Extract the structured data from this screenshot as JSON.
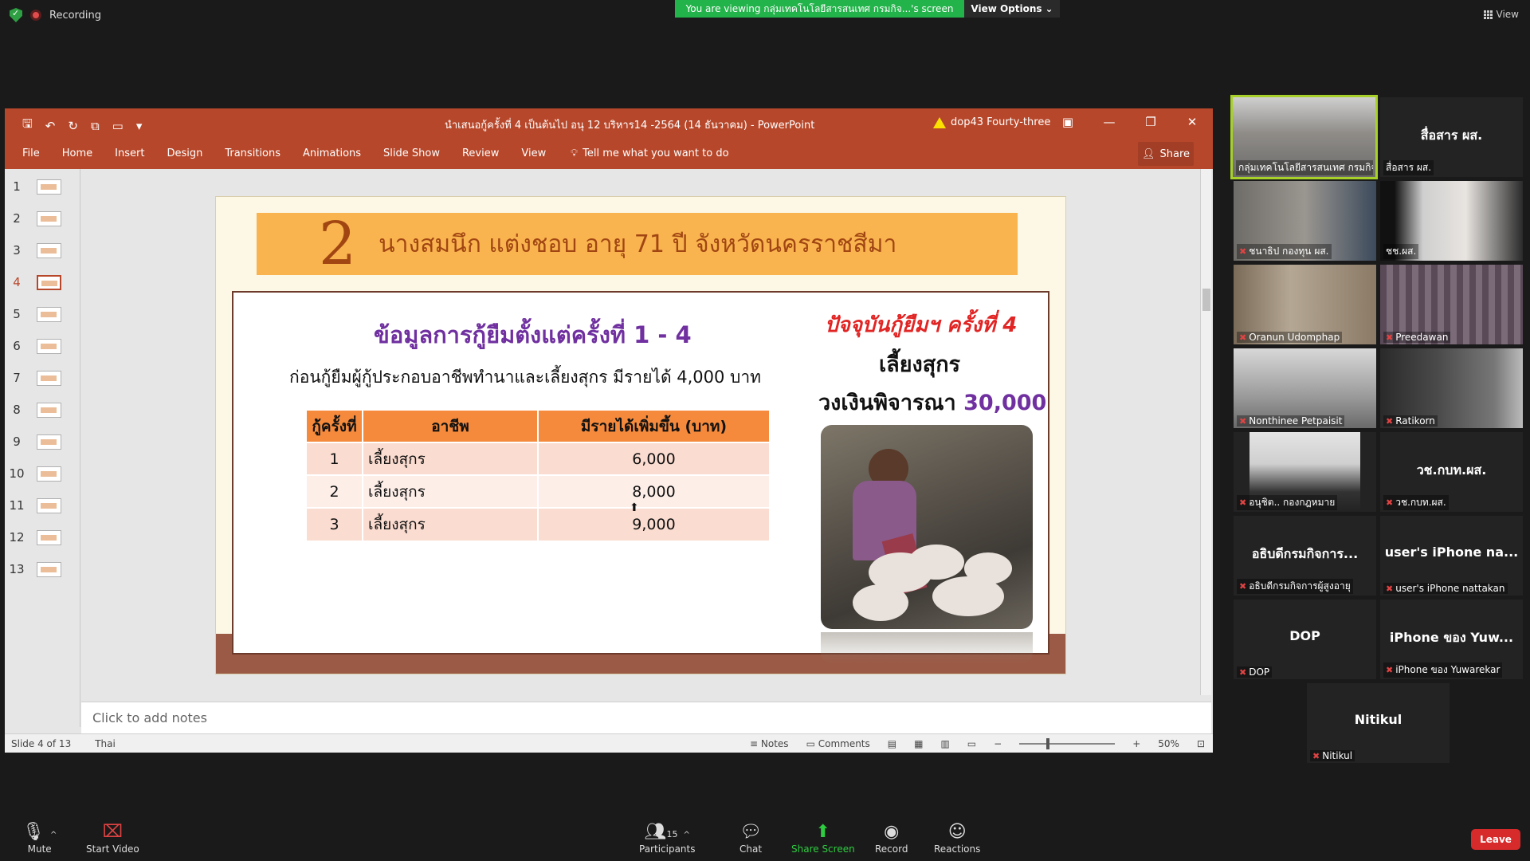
{
  "zoom": {
    "recording_label": "Recording",
    "viewing_banner": "You are viewing กลุ่มเทคโนโลยีสารสนเทศ กรมกิจ...'s screen",
    "view_options": "View Options",
    "view_label": "View"
  },
  "ppt": {
    "doc_title": "นำเสนอกู้ครั้งที่ 4 เป็นต้นไป อนุ 12 บริหาร14 -2564 (14 ธันวาคม)  -  PowerPoint",
    "user_name": "dop43 Fourty-three",
    "tabs": [
      "File",
      "Home",
      "Insert",
      "Design",
      "Transitions",
      "Animations",
      "Slide Show",
      "Review",
      "View"
    ],
    "tell_me": "Tell me what you want to do",
    "share_label": "Share",
    "slide_numbers": [
      "1",
      "2",
      "3",
      "4",
      "5",
      "6",
      "7",
      "8",
      "9",
      "10",
      "11",
      "12",
      "13"
    ],
    "notes_placeholder": "Click to add notes",
    "status_slide": "Slide 4 of 13",
    "status_lang": "Thai",
    "status_notes": "Notes",
    "status_comments": "Comments",
    "zoom_level": "50%"
  },
  "slide": {
    "number": "2",
    "name": "นางสมนึก  แต่งชอบ  อายุ 71 ปี  จังหวัดนครราชสีมา",
    "history_title": "ข้อมูลการกู้ยืมตั้งแต่ครั้งที่ 1 - 4",
    "before_text": "ก่อนกู้ยืมผู้กู้ประกอบอาชีพทำนาและเลี้ยงสุกร   มีรายได้  4,000  บาท",
    "table_headers": [
      "กู้ครั้งที่",
      "อาชีพ",
      "มีรายได้เพิ่มขึ้น (บาท)"
    ],
    "table_rows": [
      [
        "1",
        "เลี้ยงสุกร",
        "6,000"
      ],
      [
        "2",
        "เลี้ยงสุกร",
        "8,000"
      ],
      [
        "3",
        "เลี้ยงสุกร",
        "9,000"
      ]
    ],
    "current_title": "ปัจจุบันกู้ยืมฯ ครั้งที่ 4",
    "current_job": "เลี้ยงสุกร",
    "amount_label": "วงเงินพิจารณา",
    "amount_value": "30,000"
  },
  "participants": [
    {
      "label": "กลุ่มเทคโนโลยีสารสนเทศ กรมกิจ...",
      "big": ""
    },
    {
      "label": "สื่อสาร ผส.",
      "big": "สื่อสาร ผส."
    },
    {
      "label": "ชนาธิป กองทุน ผส.",
      "big": ""
    },
    {
      "label": "ชช.ผส.",
      "big": ""
    },
    {
      "label": "Oranun Udomphap",
      "big": ""
    },
    {
      "label": "Preedawan",
      "big": ""
    },
    {
      "label": "Nonthinee Petpaisit",
      "big": ""
    },
    {
      "label": "Ratikorn",
      "big": ""
    },
    {
      "label": "อนุชิต.. กองกฎหมาย",
      "big": ""
    },
    {
      "label": "วช.กบท.ผส.",
      "big": "วช.กบท.ผส."
    },
    {
      "label": "อธิบดีกรมกิจการผู้สูงอายุ",
      "big": "อธิบดีกรมกิจการ..."
    },
    {
      "label": "user's iPhone nattakan",
      "big": "user's iPhone na..."
    },
    {
      "label": "DOP",
      "big": "DOP"
    },
    {
      "label": "iPhone ของ Yuwarekar",
      "big": "iPhone ของ Yuw..."
    },
    {
      "label": "Nitikul",
      "big": "Nitikul"
    }
  ],
  "toolbar": {
    "mute": "Mute",
    "start_video": "Start Video",
    "participants": "Participants",
    "participants_count": "15",
    "chat": "Chat",
    "share_screen": "Share Screen",
    "record": "Record",
    "reactions": "Reactions",
    "leave": "Leave"
  },
  "colors": {
    "ppt_accent": "#b7472a",
    "zoom_green": "#23b34b",
    "active_speaker": "#a7d129",
    "leave_red": "#d72a2a"
  }
}
